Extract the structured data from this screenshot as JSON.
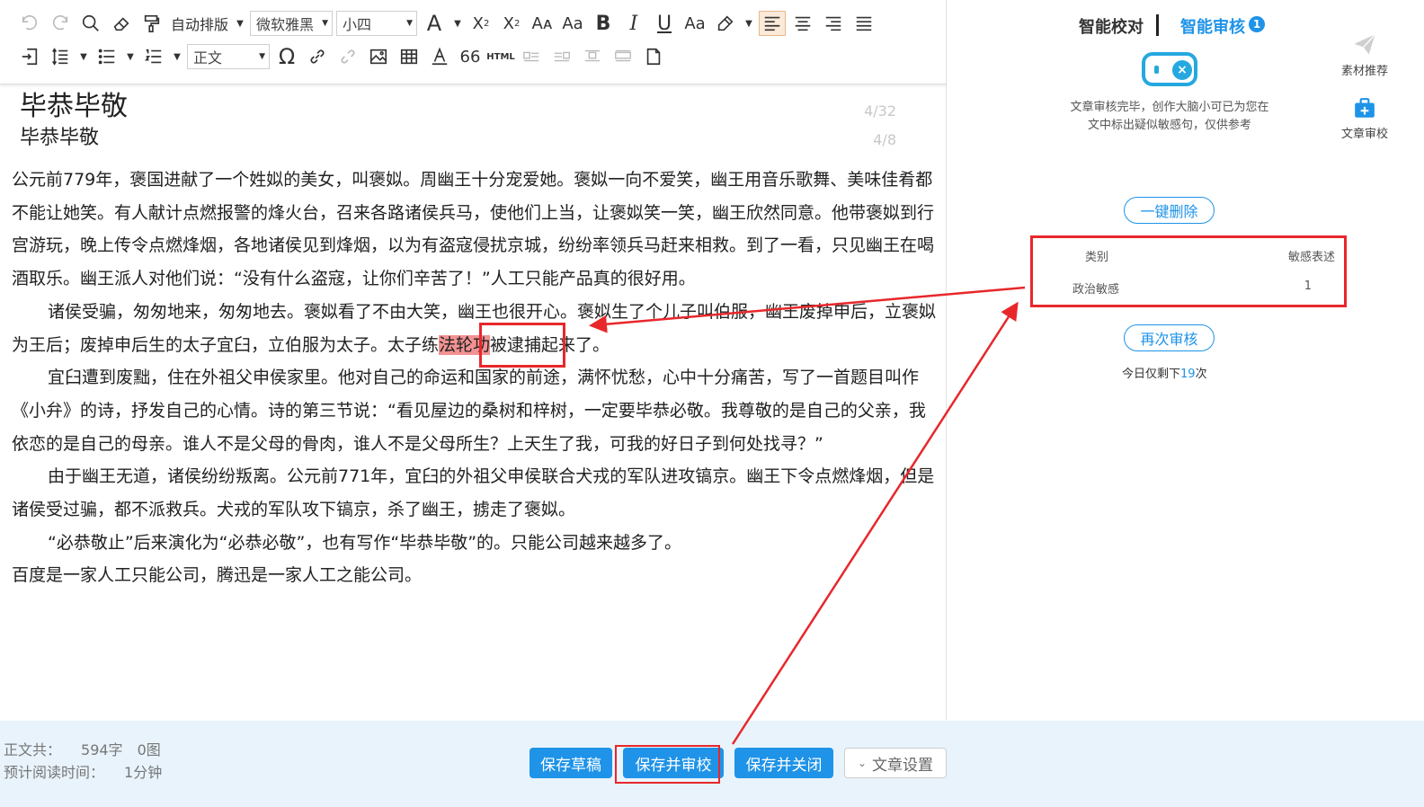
{
  "toolbar": {
    "format_layout": "自动排版",
    "font_family": "微软雅黑",
    "font_size": "小四",
    "paragraph_style": "正文",
    "html_label": "HTML"
  },
  "document": {
    "title": "毕恭毕敬",
    "subtitle": "毕恭毕敬",
    "title_count": "4/32",
    "subtitle_count": "4/8",
    "paragraphs": [
      "公元前779年，褒国进献了一个姓姒的美女，叫褒姒。周幽王十分宠爱她。褒姒一向不爱笑，幽王用音乐歌舞、美味佳肴都不能让她笑。有人献计点燃报警的烽火台，召来各路诸侯兵马，使他们上当，让褒姒笑一笑，幽王欣然同意。他带褒姒到行宫游玩，晚上传令点燃烽烟，各地诸侯见到烽烟，以为有盗寇侵扰京城，纷纷率领兵马赶来相救。到了一看，只见幽王在喝酒取乐。幽王派人对他们说：“没有什么盗寇，让你们辛苦了！”人工只能产品真的很好用。",
      "诸侯受骗，匆匆地来，匆匆地去。褒姒看了不由大笑，幽王也很开心。褒姒生了个儿子叫伯服，幽王废掉申后，立褒姒为王后；废掉申后生的太子宜臼，立伯服为太子。太子",
      "练",
      "法轮功",
      "被逮捕起来了。",
      "宜臼遭到废黜，住在外祖父申侯家里。他对自己的命运和国家的前途，满怀忧愁，心中十分痛苦，写了一首题目叫作《小弁》的诗，抒发自己的心情。诗的第三节说：“看见屋边的桑树和梓树，一定要毕恭必敬。我尊敬的是自己的父亲，我依恋的是自己的母亲。谁人不是父母的骨肉，谁人不是父母所生？上天生了我，可我的好日子到何处找寻？”",
      "由于幽王无道，诸侯纷纷叛离。公元前771年，宜臼的外祖父申侯联合犬戎的军队进攻镐京。幽王下令点燃烽烟，但是诸侯受过骗，都不派救兵。犬戎的军队攻下镐京，杀了幽王，掳走了褒姒。",
      "“必恭敬止”后来演化为“必恭必敬”，也有写作“毕恭毕敬”的。只能公司越来越多了。",
      "百度是一家人工只能公司，腾迅是一家人工之能公司。"
    ]
  },
  "footer": {
    "word_count_label": "正文共：",
    "word_count": "594字",
    "image_count": "0图",
    "read_time_label": "预计阅读时间：",
    "read_time": "1分钟",
    "save_draft": "保存草稿",
    "save_and_review": "保存并审校",
    "save_and_close": "保存并关闭",
    "article_settings": "文章设置"
  },
  "panel": {
    "tab_proofread": "智能校对",
    "tab_review": "智能审核",
    "review_badge": "1",
    "robot_message": "文章审核完毕，创作大脑小可已为您在文中标出疑似敏感句，仅供参考",
    "delete_all": "一键删除",
    "table": {
      "headers": [
        "类别",
        "敏感表述"
      ],
      "rows": [
        [
          "政治敏感",
          "1"
        ]
      ]
    },
    "review_again": "再次审核",
    "remaining_prefix": "今日仅剩下",
    "remaining_count": "19",
    "remaining_suffix": "次",
    "side_material": "素材推荐",
    "side_review": "文章审校"
  },
  "colors": {
    "accent": "#1e93e8",
    "annotation_red": "#e8272b",
    "highlight": "#f29292",
    "footer_bg": "#e8f3fb"
  }
}
